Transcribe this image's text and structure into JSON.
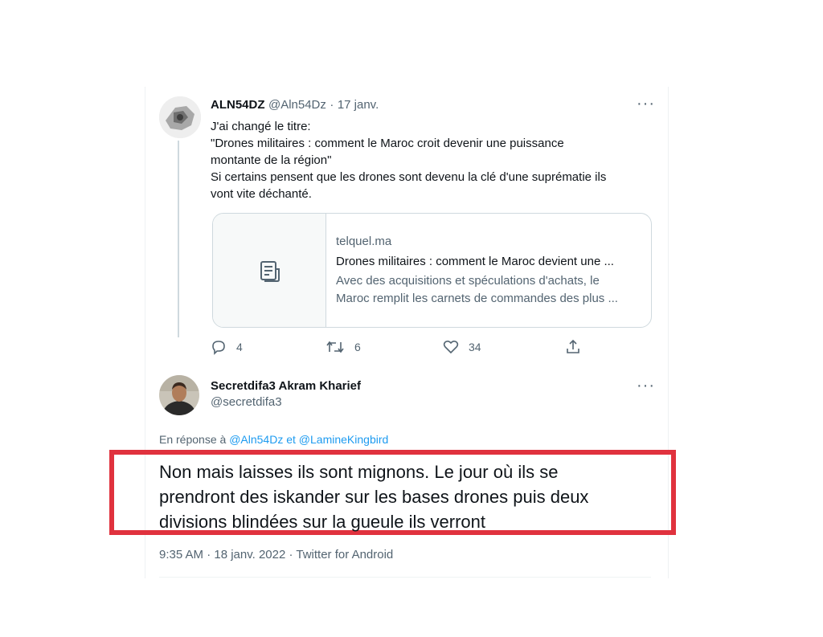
{
  "tweet1": {
    "display_name": "ALN54DZ",
    "handle": "@Aln54Dz",
    "sep": "·",
    "date": "17 janv.",
    "more": "···",
    "lines": [
      "J'ai changé le titre:",
      "\"Drones militaires : comment le Maroc croit devenir une puissance",
      "montante de la région\"",
      "Si certains pensent que les drones sont devenu la clé d'une suprématie ils",
      "vont vite déchanté."
    ],
    "link_card": {
      "domain": "telquel.ma",
      "title": "Drones militaires : comment le Maroc devient une ...",
      "desc_line1": "Avec des acquisitions et spéculations d'achats, le",
      "desc_line2": "Maroc remplit les carnets de commandes des plus ..."
    },
    "actions": {
      "replies": "4",
      "retweets": "6",
      "likes": "34"
    }
  },
  "tweet2": {
    "display_name": "Secretdifa3 Akram Kharief",
    "handle": "@secretdifa3",
    "more": "···",
    "reply_prefix": "En réponse à",
    "reply_to_1": "@Aln54Dz",
    "reply_and": "et",
    "reply_to_2": "@LamineKingbird",
    "text_lines": [
      "Non mais laisses ils sont mignons. Le jour où ils se",
      "prendront des iskander sur les bases drones puis deux",
      "divisions blindées sur la gueule ils verront"
    ],
    "meta": "9:35 AM · 18 janv. 2022 · Twitter for Android"
  },
  "colors": {
    "accent": "#1d9bf0",
    "highlight_border": "#e0323e",
    "muted": "#536471"
  }
}
